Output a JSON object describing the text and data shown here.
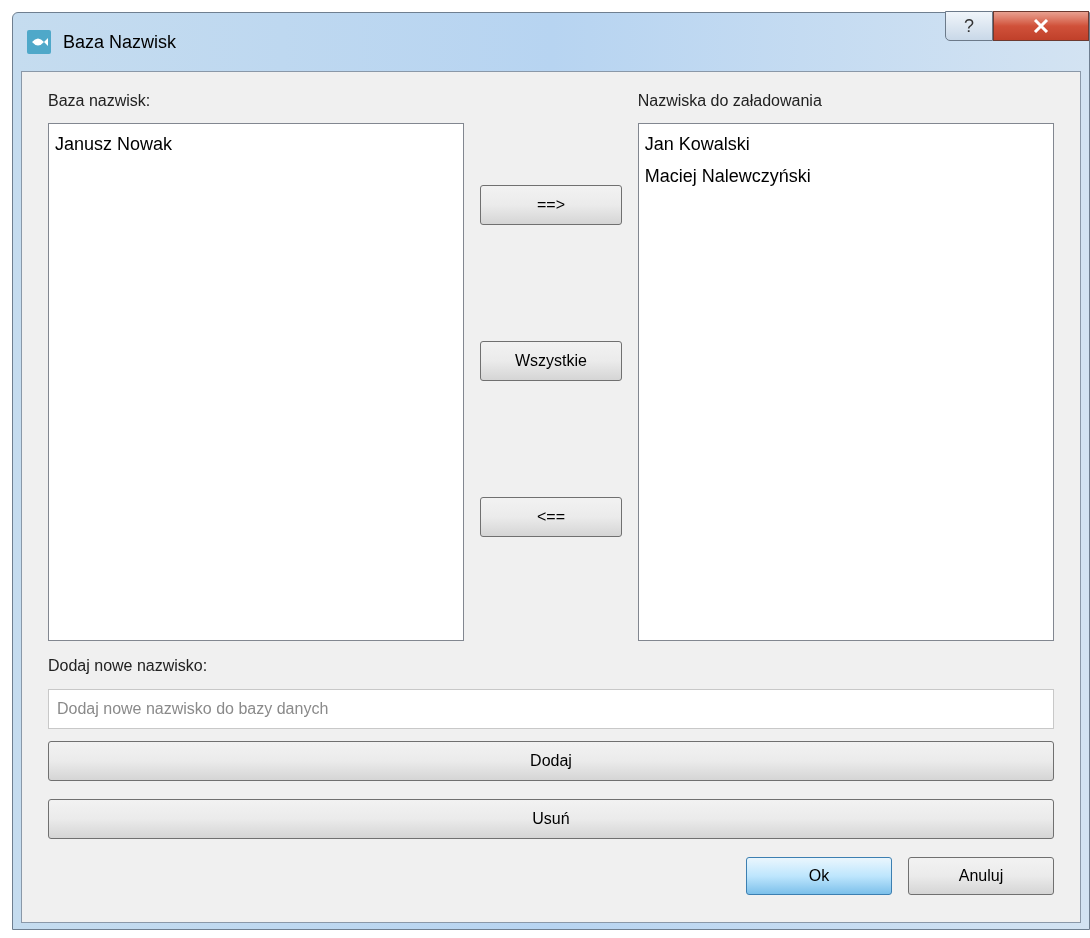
{
  "window": {
    "title": "Baza Nazwisk",
    "help_button": "?"
  },
  "left_list": {
    "label": "Baza nazwisk:",
    "items": [
      {
        "text": "Janusz Nowak",
        "selected": false
      }
    ]
  },
  "right_list": {
    "label": "Nazwiska do załadowania",
    "items": [
      {
        "text": "Jan Kowalski",
        "selected": false
      },
      {
        "text": "Maciej Nalewczyński",
        "selected": false
      }
    ]
  },
  "transfer_buttons": [
    "==>",
    "Wszystkie",
    "<=="
  ],
  "new_name": {
    "label": "Dodaj nowe nazwisko:",
    "placeholder": "Dodaj nowe nazwisko do bazy danych"
  },
  "wide_buttons": [
    "Dodaj",
    "Usuń"
  ],
  "dialog_buttons": [
    {
      "label": "Ok",
      "hovered": true
    },
    {
      "label": "Anuluj",
      "hovered": false
    }
  ]
}
